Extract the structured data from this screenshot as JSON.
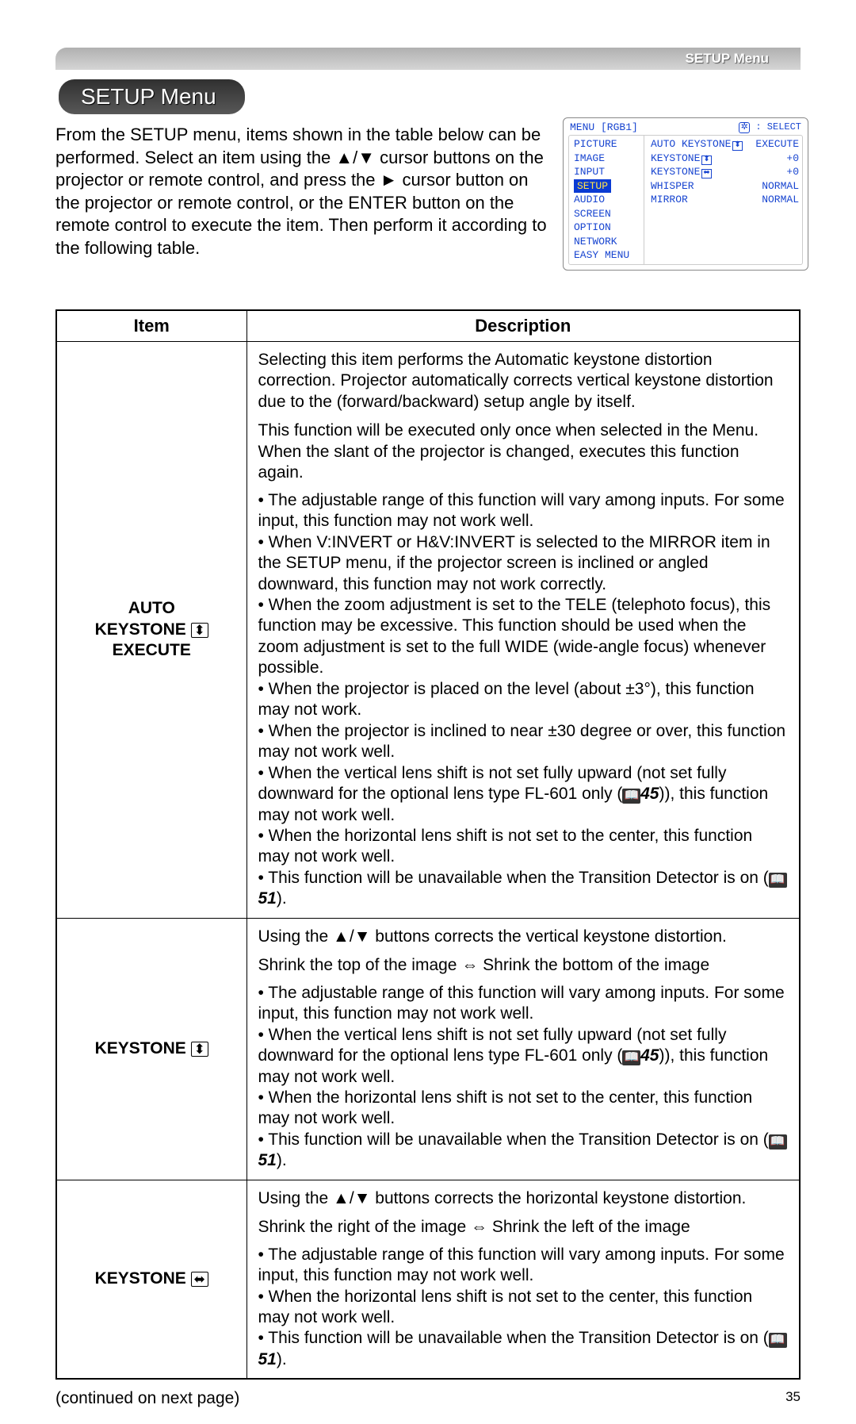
{
  "header": {
    "bar_label": "SETUP Menu",
    "pill": "SETUP Menu"
  },
  "intro": "From the SETUP menu, items shown in the table below can be performed.\nSelect an item using the ▲/▼ cursor buttons on the projector or remote control, and press the ► cursor button on the projector or remote control, or the ENTER button on the remote control to execute the item. Then perform it according to the following table.",
  "osd": {
    "title_left": "MENU [RGB1]",
    "title_right": ": SELECT",
    "left_items": [
      "PICTURE",
      "IMAGE",
      "INPUT",
      "SETUP",
      "AUDIO",
      "SCREEN",
      "OPTION",
      "NETWORK",
      "EASY MENU"
    ],
    "active_index": 3,
    "right_rows": [
      {
        "label": "AUTO KEYSTONE",
        "icon": "⬍",
        "value": "EXECUTE"
      },
      {
        "label": "KEYSTONE",
        "icon": "⬍",
        "value": "+0"
      },
      {
        "label": "KEYSTONE",
        "icon": "⬌",
        "value": "+0"
      },
      {
        "label": "WHISPER",
        "icon": "",
        "value": "NORMAL"
      },
      {
        "label": "MIRROR",
        "icon": "",
        "value": "NORMAL"
      }
    ]
  },
  "table": {
    "headers": [
      "Item",
      "Description"
    ],
    "rows": [
      {
        "item_lines": [
          "AUTO",
          "KEYSTONE",
          "EXECUTE"
        ],
        "item_icon_after_line": 1,
        "item_icon": "⬍",
        "desc_blocks": [
          "Selecting this item performs the Automatic keystone distortion correction. Projector automatically corrects vertical keystone distortion due to the (forward/backward) setup angle by itself.",
          "This function will be executed only once when selected in the Menu. When the slant of the projector is changed, executes this function again.",
          "• The adjustable range of this function will vary among inputs. For some input, this function may not work well.\n• When V:INVERT or H&V:INVERT is selected to the MIRROR item in the SETUP menu, if the projector screen is inclined or angled downward, this function may not work correctly.\n• When the zoom adjustment is set to the TELE (telephoto focus), this function may be excessive. This function should be used when the zoom adjustment is set to the full WIDE (wide-angle focus) whenever possible.\n• When the projector is placed on the level (about ±3°), this function may not work.\n• When the projector is inclined to near ±30 degree or over, this function may not work well.\n• When the vertical lens shift is not set fully upward (not set fully downward for the optional lens type FL-601 only (📖45)), this function may not work well.\n• When the horizontal lens shift is not set to the center, this function may not work well.\n• This function will be unavailable when the Transition Detector is on (📖51)."
        ]
      },
      {
        "item_lines": [
          "KEYSTONE"
        ],
        "item_icon": "⬍",
        "desc_blocks": [
          "Using the ▲/▼ buttons corrects the vertical keystone distortion.",
          "Shrink the top of the image ⇔ Shrink the bottom of the image",
          "• The adjustable range of this function will vary among inputs. For some input, this function may not work well.\n• When the vertical lens shift is not set fully upward (not set fully downward for the optional lens type FL-601 only (📖45)), this function may not work well.\n• When the horizontal lens shift is not set to the center, this function may not work well.\n• This function will be unavailable when the Transition Detector is on (📖51)."
        ]
      },
      {
        "item_lines": [
          "KEYSTONE"
        ],
        "item_icon": "⬌",
        "desc_blocks": [
          "Using the ▲/▼ buttons corrects the horizontal keystone distortion.",
          "Shrink the right of the image ⇔ Shrink the left of the image",
          "• The adjustable range of this function will vary among inputs. For some input, this function may not work well.\n• When the horizontal lens shift is not set to the center, this function may not work well.\n• This function will be unavailable when the Transition Detector is on (📖51)."
        ]
      }
    ]
  },
  "footer": {
    "continued": "(continued on next page)",
    "page_number": "35"
  }
}
